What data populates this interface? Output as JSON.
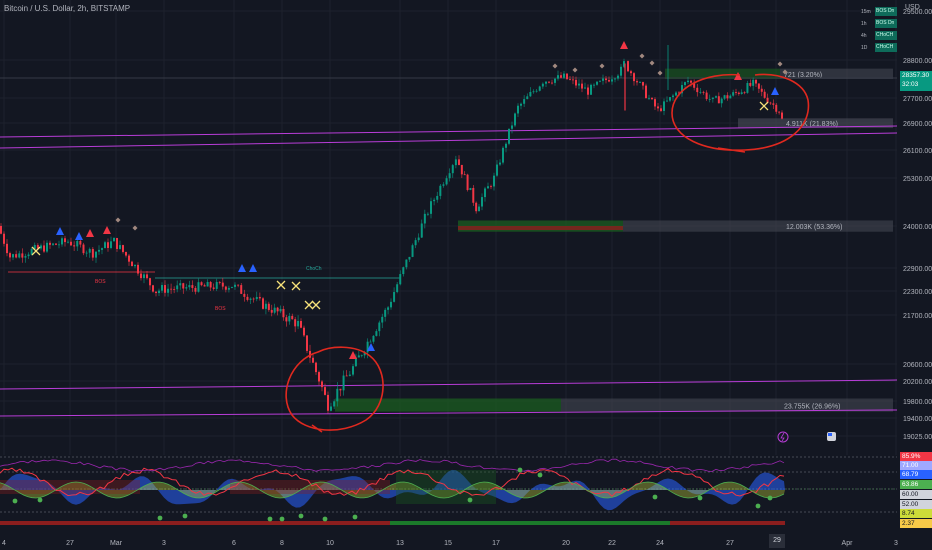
{
  "header": {
    "symbol_title": "Bitcoin / U.S. Dollar, 2h, BITSTAMP",
    "currency": "USD"
  },
  "timeframe_panel": [
    {
      "tf": "15m",
      "status": "BOS Dn"
    },
    {
      "tf": "1h",
      "status": "BOS Dn"
    },
    {
      "tf": "4h",
      "status": "CHoCH"
    },
    {
      "tf": "1D",
      "status": "CHoCH"
    }
  ],
  "current_price": {
    "price": "28357.30",
    "countdown": "32:03"
  },
  "chart_data": {
    "type": "candlestick",
    "title": "Bitcoin / U.S. Dollar, 2h, BITSTAMP",
    "xlabel": "",
    "ylabel": "",
    "y_ticks": [
      "29500.00",
      "28800.00",
      "27700.00",
      "26900.00",
      "26100.00",
      "25300.00",
      "24000.00",
      "22900.00",
      "22300.00",
      "21700.00",
      "20600.00",
      "20200.00",
      "19800.00",
      "19400.00",
      "19025.00"
    ],
    "x_ticks": [
      "4",
      "27",
      "Mar",
      "3",
      "6",
      "8",
      "10",
      "13",
      "15",
      "17",
      "20",
      "22",
      "24",
      "27",
      "29",
      "Apr",
      "3"
    ],
    "current_x_label": "29",
    "price_path": [
      {
        "x": "Feb 24",
        "price": 24000
      },
      {
        "x": "Feb 25",
        "price": 23200
      },
      {
        "x": "Feb 26",
        "price": 23400
      },
      {
        "x": "Feb 27",
        "price": 23600
      },
      {
        "x": "Feb 28",
        "price": 23300
      },
      {
        "x": "Mar 1",
        "price": 23600
      },
      {
        "x": "Mar 2",
        "price": 22300
      },
      {
        "x": "Mar 3",
        "price": 22350
      },
      {
        "x": "Mar 6",
        "price": 22450
      },
      {
        "x": "Mar 7",
        "price": 22000
      },
      {
        "x": "Mar 9",
        "price": 21500
      },
      {
        "x": "Mar 10",
        "price": 19700
      },
      {
        "x": "Mar 11",
        "price": 20400
      },
      {
        "x": "Mar 12",
        "price": 21900
      },
      {
        "x": "Mar 13",
        "price": 24400
      },
      {
        "x": "Mar 14",
        "price": 25900
      },
      {
        "x": "Mar 15",
        "price": 24500
      },
      {
        "x": "Mar 16",
        "price": 25300
      },
      {
        "x": "Mar 17",
        "price": 27400
      },
      {
        "x": "Mar 18",
        "price": 28200
      },
      {
        "x": "Mar 19",
        "price": 28300
      },
      {
        "x": "Mar 20",
        "price": 27900
      },
      {
        "x": "Mar 21",
        "price": 28500
      },
      {
        "x": "Mar 22",
        "price": 28700
      },
      {
        "x": "Mar 22b",
        "price": 27300
      },
      {
        "x": "Mar 23",
        "price": 28200
      },
      {
        "x": "Mar 24",
        "price": 27600
      },
      {
        "x": "Mar 25",
        "price": 27800
      },
      {
        "x": "Mar 26",
        "price": 28100
      },
      {
        "x": "Mar 27",
        "price": 27300
      },
      {
        "x": "Mar 28",
        "price": 27000
      },
      {
        "x": "Mar 29",
        "price": 28357
      }
    ],
    "level_labels": [
      {
        "text": "721 (3.20%)",
        "price": 28400
      },
      {
        "text": "4.911K (21.83%)",
        "price": 26900
      },
      {
        "text": "12.003K (53.36%)",
        "price": 24000
      },
      {
        "text": "23.755K (26.96%)",
        "price": 19700
      }
    ],
    "structure_labels": [
      "BOS",
      "BOS",
      "ChoCh"
    ],
    "annotations": [
      "red circle around Mar 10 low",
      "red circle around Mar 24-28 range"
    ],
    "oscillator": {
      "right_labels": [
        {
          "text": "85.9%",
          "color": "#f23645"
        },
        {
          "text": "71.00",
          "color": "#9fa9ff"
        },
        {
          "text": "68.79",
          "color": "#2962ff"
        },
        {
          "text": "63.86",
          "color": "#4caf50"
        },
        {
          "text": "60.00",
          "color": "#d1d4dc"
        },
        {
          "text": "52.00",
          "color": "#d1d4dc"
        },
        {
          "text": "8.74",
          "color": "#cddc39"
        },
        {
          "text": "2.37",
          "color": "#f7c948"
        }
      ]
    }
  },
  "colors": {
    "up": "#089981",
    "down": "#f23645",
    "magenta_line": "#b83dd8",
    "green_zone": "#1b5e20",
    "grey_zone": "#434651",
    "annotation": "#e0291f"
  }
}
